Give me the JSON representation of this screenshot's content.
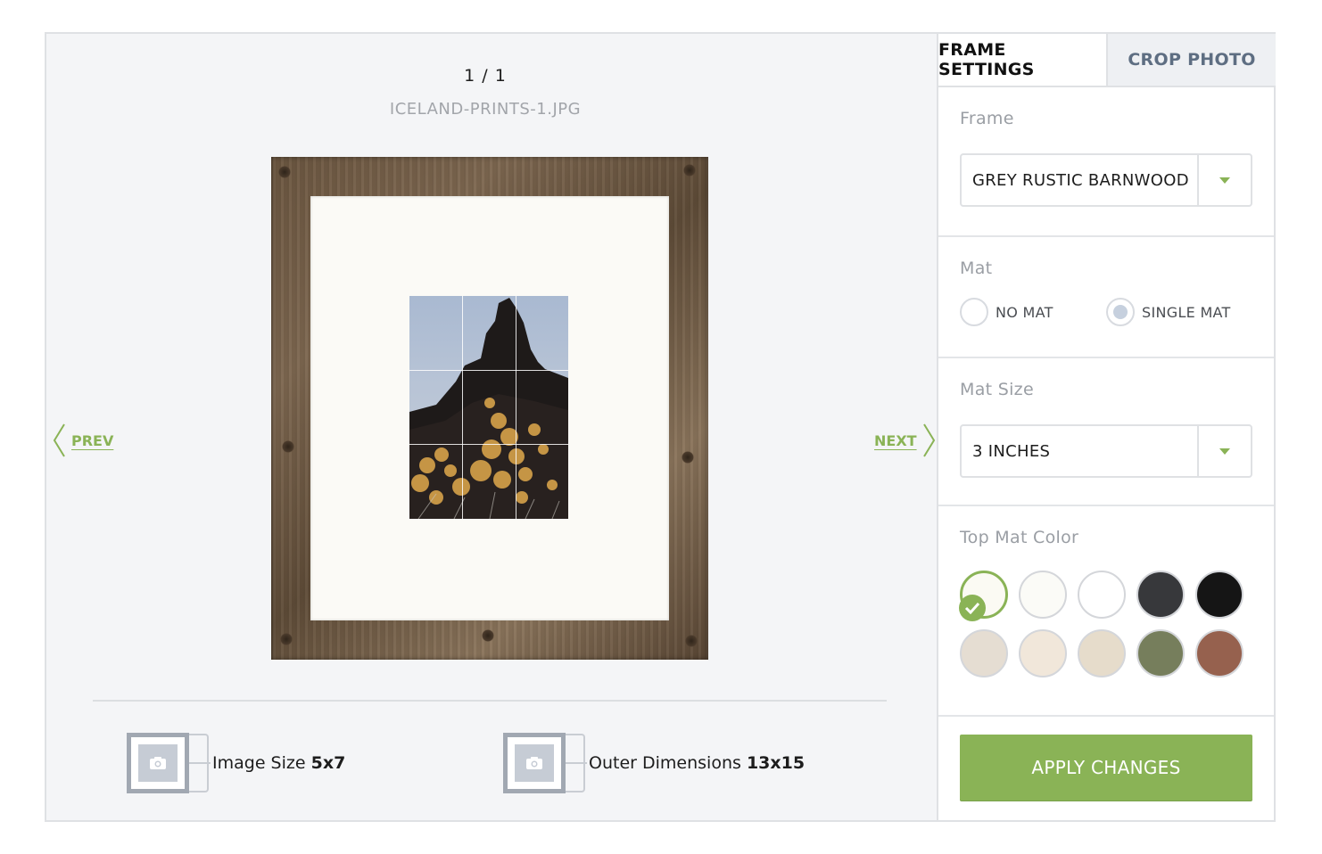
{
  "preview": {
    "counter": "1 / 1",
    "filename": "ICELAND-PRINTS-1.JPG",
    "prev_label": "PREV",
    "next_label": "NEXT",
    "image_size_label": "Image Size",
    "image_size_value": "5x7",
    "outer_dims_label": "Outer Dimensions",
    "outer_dims_value": "13x15"
  },
  "tabs": [
    {
      "label": "FRAME SETTINGS",
      "active": true
    },
    {
      "label": "CROP PHOTO",
      "active": false
    }
  ],
  "frame_section": {
    "label": "Frame",
    "selected": "GREY RUSTIC BARNWOOD"
  },
  "mat_section": {
    "label": "Mat",
    "options": [
      {
        "label": "NO MAT",
        "checked": false
      },
      {
        "label": "SINGLE MAT",
        "checked": true
      }
    ]
  },
  "mat_size_section": {
    "label": "Mat Size",
    "selected": "3 INCHES"
  },
  "mat_color_section": {
    "label": "Top Mat Color",
    "swatches": [
      {
        "color": "#fbfaf3",
        "selected": true
      },
      {
        "color": "#fbfbf7",
        "selected": false
      },
      {
        "color": "#ffffff",
        "selected": false
      },
      {
        "color": "#37383b",
        "selected": false
      },
      {
        "color": "#151515",
        "selected": false
      },
      {
        "color": "#e5ddd2",
        "selected": false
      },
      {
        "color": "#f1e7da",
        "selected": false
      },
      {
        "color": "#e6dccb",
        "selected": false
      },
      {
        "color": "#767e5c",
        "selected": false
      },
      {
        "color": "#96614e",
        "selected": false
      }
    ]
  },
  "apply_label": "APPLY CHANGES",
  "colors": {
    "accent": "#8ab356",
    "tab_inactive_text": "#5e6e82",
    "frame_wood": "#6b5640",
    "mat": "#fbfaf6"
  },
  "icons": [
    "chevron-left-icon",
    "chevron-right-icon",
    "camera-icon",
    "dropdown-arrow-icon",
    "checkmark-icon"
  ]
}
